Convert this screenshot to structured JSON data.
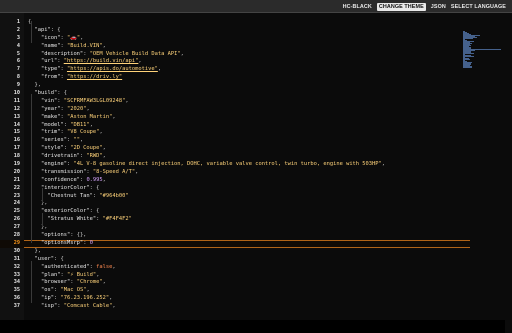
{
  "toolbar": {
    "theme": "HC-BLACK",
    "change_theme": "CHANGE THEME",
    "json": "JSON",
    "select_language": "SELECT LANGUAGE"
  },
  "editor": {
    "highlighted_line": 29,
    "lines": [
      {
        "n": "1",
        "segs": [
          [
            "{",
            "p"
          ]
        ]
      },
      {
        "n": "2",
        "segs": [
          [
            "  ",
            "p"
          ],
          [
            "\"api\"",
            "k"
          ],
          [
            ": {",
            "p"
          ]
        ]
      },
      {
        "n": "3",
        "segs": [
          [
            "    ",
            "p"
          ],
          [
            "\"icon\"",
            "k"
          ],
          [
            ": ",
            "p"
          ],
          [
            "\"🚗\"",
            "s"
          ],
          [
            ",",
            "p"
          ]
        ]
      },
      {
        "n": "4",
        "segs": [
          [
            "    ",
            "p"
          ],
          [
            "\"name\"",
            "k"
          ],
          [
            ": ",
            "p"
          ],
          [
            "\"Build.VIN\"",
            "s"
          ],
          [
            ",",
            "p"
          ]
        ]
      },
      {
        "n": "5",
        "segs": [
          [
            "    ",
            "p"
          ],
          [
            "\"description\"",
            "k"
          ],
          [
            ": ",
            "p"
          ],
          [
            "\"OEM Vehicle Build Data API\"",
            "s"
          ],
          [
            ",",
            "p"
          ]
        ]
      },
      {
        "n": "6",
        "segs": [
          [
            "    ",
            "p"
          ],
          [
            "\"url\"",
            "k"
          ],
          [
            ": ",
            "p"
          ],
          [
            "\"https://build.vin/api\"",
            "u"
          ],
          [
            ",",
            "p"
          ]
        ]
      },
      {
        "n": "7",
        "segs": [
          [
            "    ",
            "p"
          ],
          [
            "\"type\"",
            "k"
          ],
          [
            ": ",
            "p"
          ],
          [
            "\"https://apis.do/automotive\"",
            "u"
          ],
          [
            ",",
            "p"
          ]
        ]
      },
      {
        "n": "8",
        "segs": [
          [
            "    ",
            "p"
          ],
          [
            "\"from\"",
            "k"
          ],
          [
            ": ",
            "p"
          ],
          [
            "\"https://driv.ly\"",
            "u"
          ]
        ]
      },
      {
        "n": "9",
        "segs": [
          [
            "  },",
            "p"
          ]
        ]
      },
      {
        "n": "10",
        "segs": [
          [
            "  ",
            "p"
          ],
          [
            "\"build\"",
            "k"
          ],
          [
            ": {",
            "p"
          ]
        ]
      },
      {
        "n": "11",
        "segs": [
          [
            "    ",
            "p"
          ],
          [
            "\"vin\"",
            "k"
          ],
          [
            ": ",
            "p"
          ],
          [
            "\"SCFRMFAW3LGL09248\"",
            "s"
          ],
          [
            ",",
            "p"
          ]
        ]
      },
      {
        "n": "12",
        "segs": [
          [
            "    ",
            "p"
          ],
          [
            "\"year\"",
            "k"
          ],
          [
            ": ",
            "p"
          ],
          [
            "\"2020\"",
            "s"
          ],
          [
            ",",
            "p"
          ]
        ]
      },
      {
        "n": "13",
        "segs": [
          [
            "    ",
            "p"
          ],
          [
            "\"make\"",
            "k"
          ],
          [
            ": ",
            "p"
          ],
          [
            "\"Aston Martin\"",
            "s"
          ],
          [
            ",",
            "p"
          ]
        ]
      },
      {
        "n": "14",
        "segs": [
          [
            "    ",
            "p"
          ],
          [
            "\"model\"",
            "k"
          ],
          [
            ": ",
            "p"
          ],
          [
            "\"DB11\"",
            "s"
          ],
          [
            ",",
            "p"
          ]
        ]
      },
      {
        "n": "15",
        "segs": [
          [
            "    ",
            "p"
          ],
          [
            "\"trim\"",
            "k"
          ],
          [
            ": ",
            "p"
          ],
          [
            "\"V8 Coupe\"",
            "s"
          ],
          [
            ",",
            "p"
          ]
        ]
      },
      {
        "n": "16",
        "segs": [
          [
            "    ",
            "p"
          ],
          [
            "\"series\"",
            "k"
          ],
          [
            ": ",
            "p"
          ],
          [
            "\"\"",
            "s"
          ],
          [
            ",",
            "p"
          ]
        ]
      },
      {
        "n": "17",
        "segs": [
          [
            "    ",
            "p"
          ],
          [
            "\"style\"",
            "k"
          ],
          [
            ": ",
            "p"
          ],
          [
            "\"2D Coupe\"",
            "s"
          ],
          [
            ",",
            "p"
          ]
        ]
      },
      {
        "n": "18",
        "segs": [
          [
            "    ",
            "p"
          ],
          [
            "\"drivetrain\"",
            "k"
          ],
          [
            ": ",
            "p"
          ],
          [
            "\"RWD\"",
            "s"
          ],
          [
            ",",
            "p"
          ]
        ]
      },
      {
        "n": "19",
        "segs": [
          [
            "    ",
            "p"
          ],
          [
            "\"engine\"",
            "k"
          ],
          [
            ": ",
            "p"
          ],
          [
            "\"4L V-8 gasoline direct injection, DOHC, variable valve control, twin turbo, engine with 503HP\"",
            "s"
          ],
          [
            ",",
            "p"
          ]
        ]
      },
      {
        "n": "20",
        "segs": [
          [
            "    ",
            "p"
          ],
          [
            "\"transmission\"",
            "k"
          ],
          [
            ": ",
            "p"
          ],
          [
            "\"8-Speed A/T\"",
            "s"
          ],
          [
            ",",
            "p"
          ]
        ]
      },
      {
        "n": "21",
        "segs": [
          [
            "    ",
            "p"
          ],
          [
            "\"confidence\"",
            "k"
          ],
          [
            ": ",
            "p"
          ],
          [
            "0.995",
            "n"
          ],
          [
            ",",
            "p"
          ]
        ]
      },
      {
        "n": "22",
        "segs": [
          [
            "    ",
            "p"
          ],
          [
            "\"interiorColor\"",
            "k"
          ],
          [
            ": {",
            "p"
          ]
        ]
      },
      {
        "n": "23",
        "segs": [
          [
            "      ",
            "p"
          ],
          [
            "\"Chestnut Tan\"",
            "k"
          ],
          [
            ": ",
            "p"
          ],
          [
            "\"#964b00\"",
            "s"
          ]
        ]
      },
      {
        "n": "24",
        "segs": [
          [
            "    },",
            "p"
          ]
        ]
      },
      {
        "n": "25",
        "segs": [
          [
            "    ",
            "p"
          ],
          [
            "\"exteriorColor\"",
            "k"
          ],
          [
            ": {",
            "p"
          ]
        ]
      },
      {
        "n": "26",
        "segs": [
          [
            "      ",
            "p"
          ],
          [
            "\"Stratus White\"",
            "k"
          ],
          [
            ": ",
            "p"
          ],
          [
            "\"#F4F4F2\"",
            "s"
          ]
        ]
      },
      {
        "n": "27",
        "segs": [
          [
            "    },",
            "p"
          ]
        ]
      },
      {
        "n": "28",
        "segs": [
          [
            "    ",
            "p"
          ],
          [
            "\"options\"",
            "k"
          ],
          [
            ": {},",
            "p"
          ]
        ]
      },
      {
        "n": "29",
        "segs": [
          [
            "    ",
            "p"
          ],
          [
            "\"optionsMsrp\"",
            "k"
          ],
          [
            ": ",
            "p"
          ],
          [
            "0",
            "n"
          ]
        ]
      },
      {
        "n": "30",
        "segs": [
          [
            "  },",
            "p"
          ]
        ]
      },
      {
        "n": "31",
        "segs": [
          [
            "  ",
            "p"
          ],
          [
            "\"user\"",
            "k"
          ],
          [
            ": {",
            "p"
          ]
        ]
      },
      {
        "n": "32",
        "segs": [
          [
            "    ",
            "p"
          ],
          [
            "\"authenticated\"",
            "k"
          ],
          [
            ": ",
            "p"
          ],
          [
            "false",
            "b"
          ],
          [
            ",",
            "p"
          ]
        ]
      },
      {
        "n": "33",
        "segs": [
          [
            "    ",
            "p"
          ],
          [
            "\"plan\"",
            "k"
          ],
          [
            ": ",
            "p"
          ],
          [
            "\"⚡ Build\"",
            "s"
          ],
          [
            ",",
            "p"
          ]
        ]
      },
      {
        "n": "34",
        "segs": [
          [
            "    ",
            "p"
          ],
          [
            "\"browser\"",
            "k"
          ],
          [
            ": ",
            "p"
          ],
          [
            "\"Chrome\"",
            "s"
          ],
          [
            ",",
            "p"
          ]
        ]
      },
      {
        "n": "35",
        "segs": [
          [
            "    ",
            "p"
          ],
          [
            "\"os\"",
            "k"
          ],
          [
            ": ",
            "p"
          ],
          [
            "\"Mac OS\"",
            "s"
          ],
          [
            ",",
            "p"
          ]
        ]
      },
      {
        "n": "36",
        "segs": [
          [
            "    ",
            "p"
          ],
          [
            "\"ip\"",
            "k"
          ],
          [
            ": ",
            "p"
          ],
          [
            "\"76.23.196.252\"",
            "s"
          ],
          [
            ",",
            "p"
          ]
        ]
      },
      {
        "n": "37",
        "segs": [
          [
            "    ",
            "p"
          ],
          [
            "\"isp\"",
            "k"
          ],
          [
            ": ",
            "p"
          ],
          [
            "\"Comcast Cable\"",
            "s"
          ],
          [
            ",",
            "p"
          ]
        ]
      }
    ]
  },
  "colors": {
    "background": "#000000",
    "line_highlight": "#b06418",
    "key": "#e8e8e8",
    "string": "#ffd37a",
    "number": "#d8a6ff",
    "boolean": "#ff8a50"
  }
}
